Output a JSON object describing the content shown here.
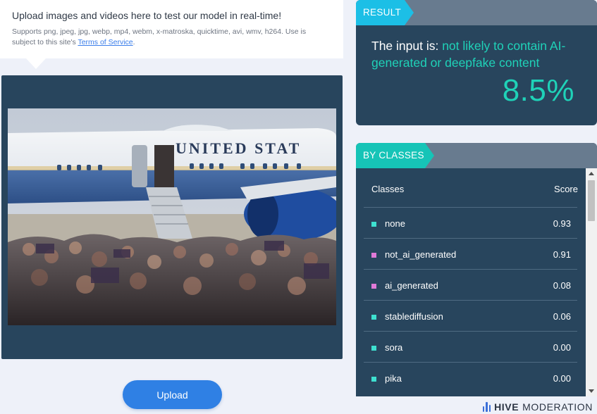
{
  "upload_info": {
    "title": "Upload images and videos here to test our model in real-time!",
    "subtitle_prefix": "Supports png, jpeg, jpg, webp, mp4, webm, x-matroska, quicktime, avi, wmv, h264. Use is subject to this site's ",
    "tos_link": "Terms of Service",
    "subtitle_suffix": "."
  },
  "preview": {
    "photo_text": "UNITED STAT"
  },
  "upload_button": "Upload",
  "result": {
    "tag": "RESULT",
    "prefix": "The input is: ",
    "verdict": "not likely to contain AI-generated or deepfake content",
    "score": "8.5%"
  },
  "classes": {
    "tag": "BY CLASSES",
    "col_class": "Classes",
    "col_score": "Score",
    "rows": [
      {
        "name": "none",
        "score": "0.93",
        "color": "#3ee0d0"
      },
      {
        "name": "not_ai_generated",
        "score": "0.91",
        "color": "#e07ad8"
      },
      {
        "name": "ai_generated",
        "score": "0.08",
        "color": "#e07ad8"
      },
      {
        "name": "stablediffusion",
        "score": "0.06",
        "color": "#3ee0d0"
      },
      {
        "name": "sora",
        "score": "0.00",
        "color": "#3ee0d0"
      },
      {
        "name": "pika",
        "score": "0.00",
        "color": "#3ee0d0"
      }
    ]
  },
  "brand": {
    "bold": "HIVE",
    "light": "MODERATION"
  },
  "colors": {
    "panel": "#28455d",
    "accent_teal": "#1fd2b8",
    "accent_cyan": "#1cbfe6",
    "button_blue": "#2f80e4"
  }
}
